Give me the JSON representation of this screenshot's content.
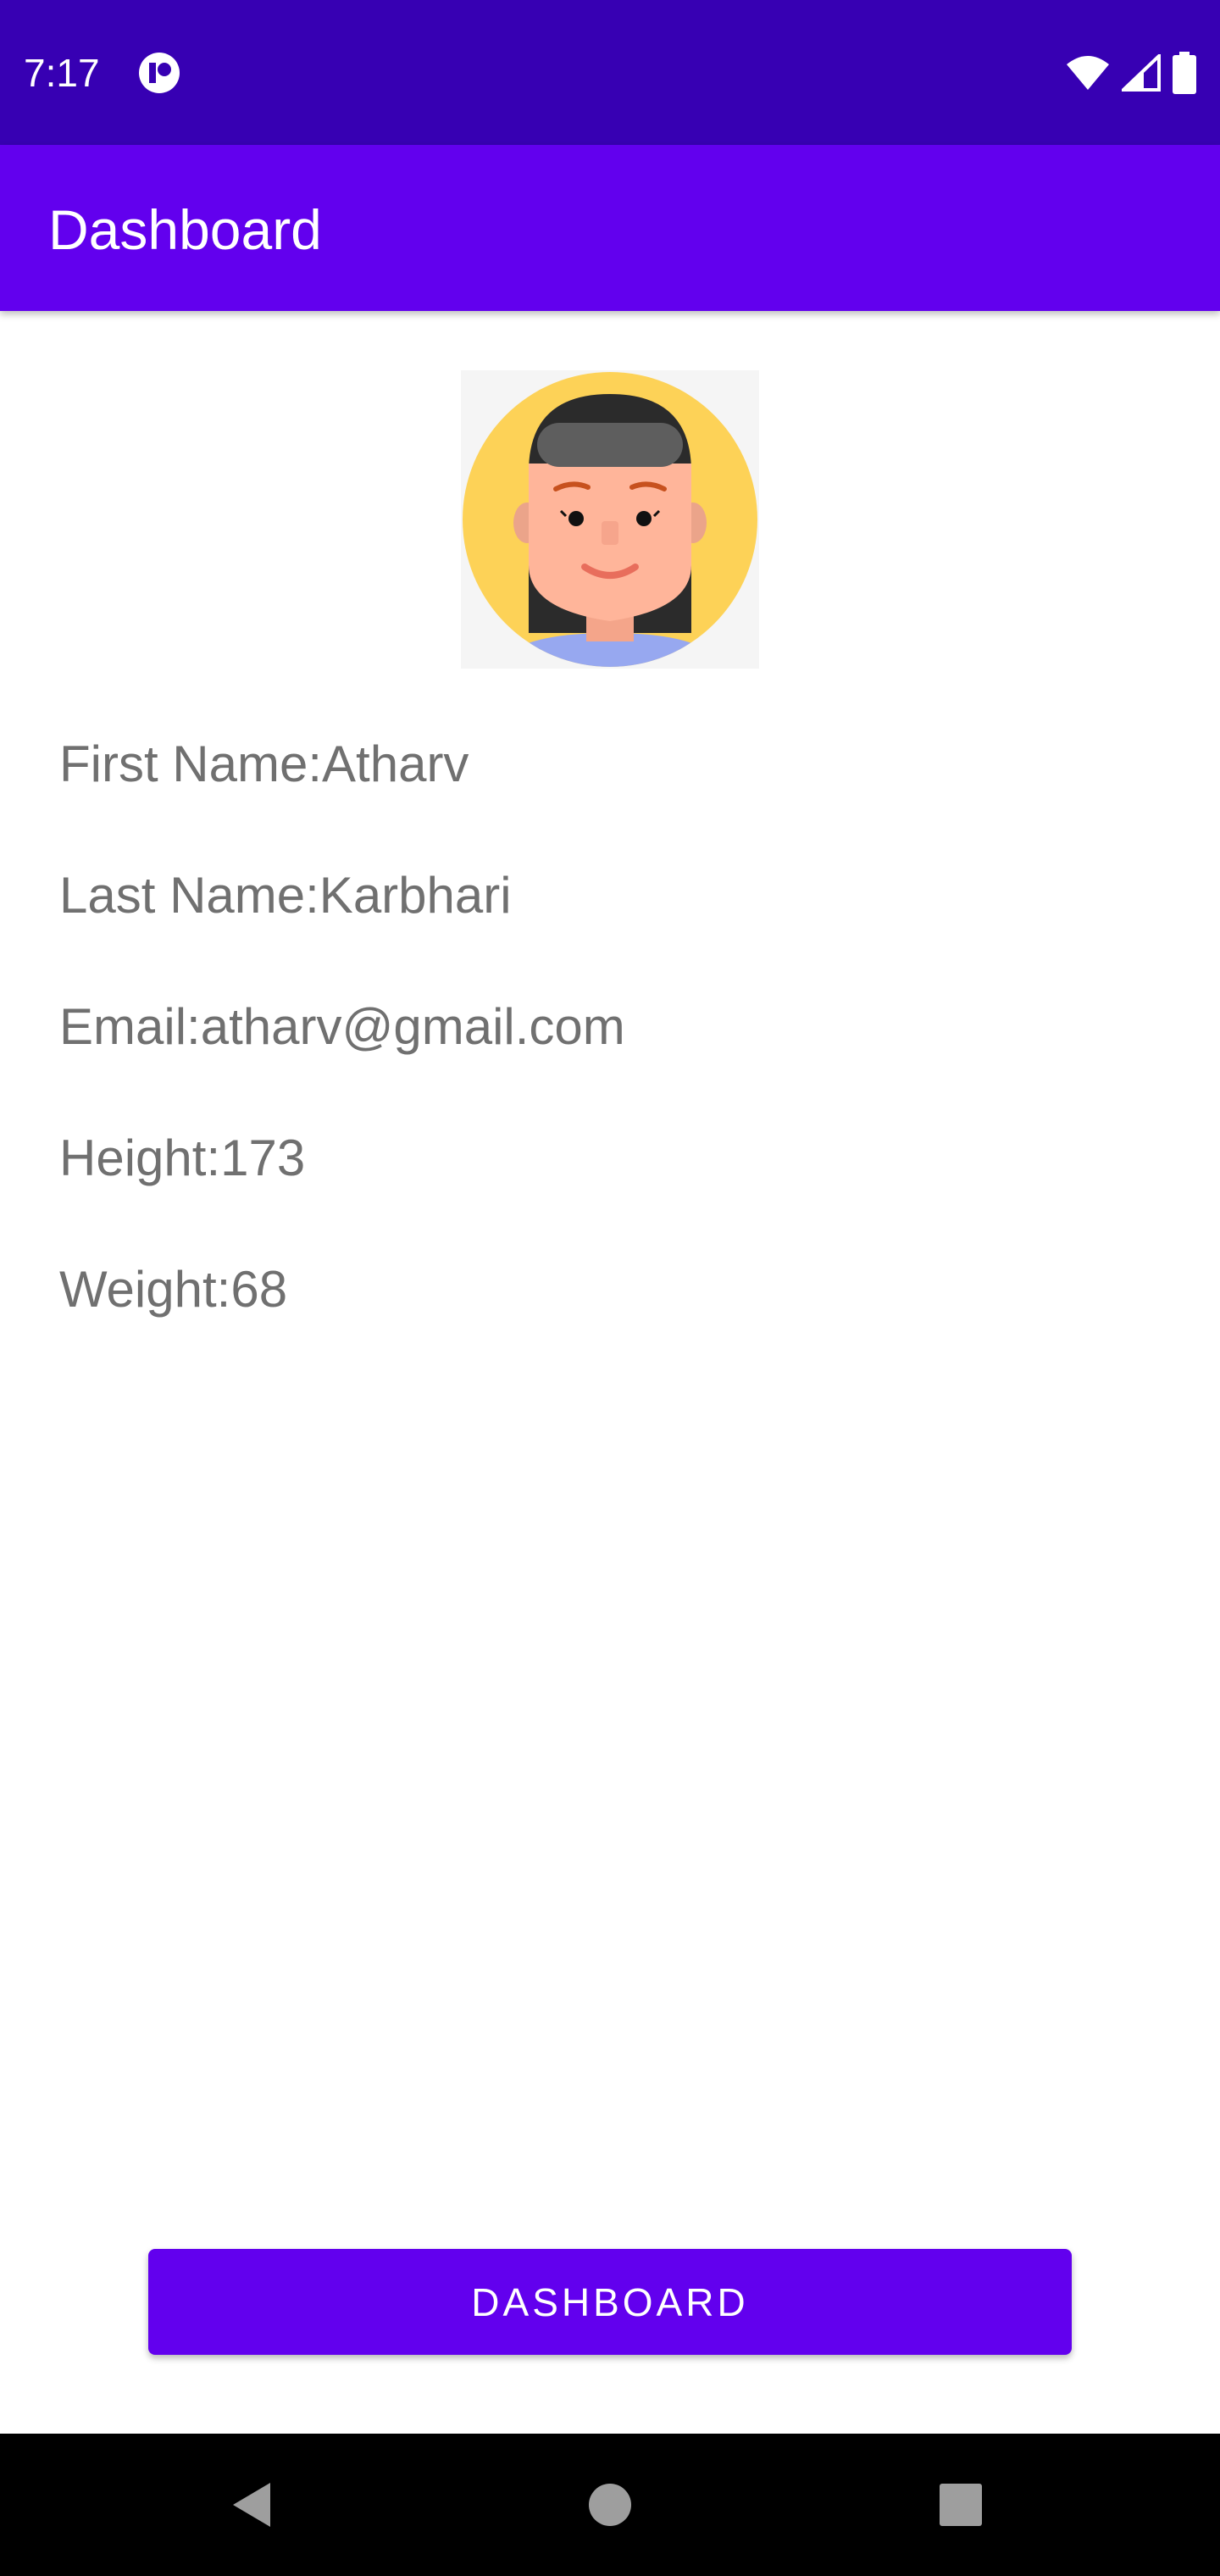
{
  "status_bar": {
    "time": "7:17",
    "background": "#3700B3"
  },
  "app_bar": {
    "title": "Dashboard",
    "background": "#6200EE"
  },
  "avatar": {
    "icon": "profile-avatar"
  },
  "profile": {
    "first_name": "First Name:Atharv",
    "last_name": "Last Name:Karbhari",
    "email": "Email:atharv@gmail.com",
    "height": "Height:173",
    "weight": "Weight:68"
  },
  "actions": {
    "dashboard_label": "DASHBOARD",
    "accent": "#6200EE"
  },
  "nav_bar": {
    "back_icon": "back-icon",
    "home_icon": "home-icon",
    "recents_icon": "recents-icon"
  }
}
